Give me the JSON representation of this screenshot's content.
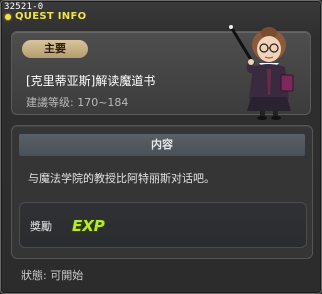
{
  "window": {
    "quest_id": "32521-0",
    "title": "QUEST INFO"
  },
  "header": {
    "badge": "主要",
    "quest_name": "[克里蒂亚斯]解读魔道书",
    "level_label": "建議等级: 170~184"
  },
  "content": {
    "section_title": "内容",
    "description": "与魔法学院的教授比阿特丽斯对话吧。"
  },
  "reward": {
    "label": "獎勵",
    "exp_text": "EXP"
  },
  "status": {
    "text": "狀態: 可開始"
  },
  "colors": {
    "title": "#f2e34a",
    "badge_bg": "#c9b384",
    "exp_fill": "#b8ea2a"
  }
}
